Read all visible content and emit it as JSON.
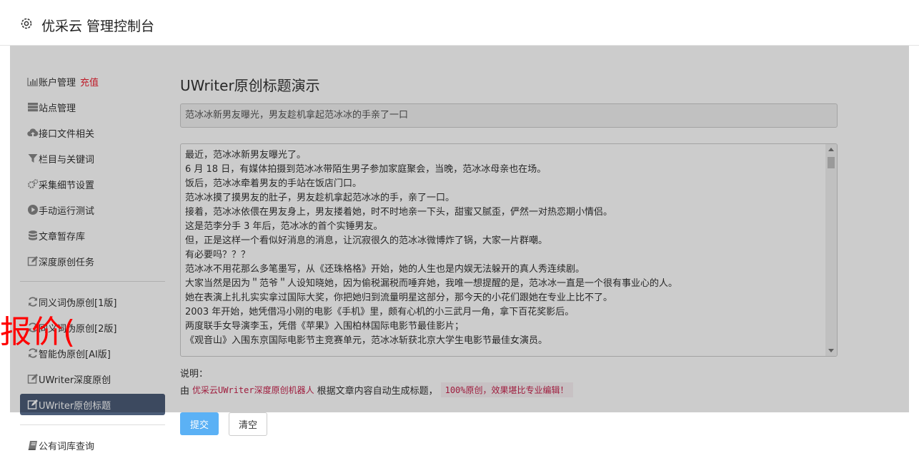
{
  "header": {
    "title": "优采云 管理控制台"
  },
  "sidebar": {
    "items": [
      {
        "label": "账户管理",
        "badge": "充值"
      },
      {
        "label": "站点管理"
      },
      {
        "label": "接口文件相关"
      },
      {
        "label": "栏目与关键词"
      },
      {
        "label": "采集细节设置"
      },
      {
        "label": "手动运行测试"
      },
      {
        "label": "文章暂存库"
      },
      {
        "label": "深度原创任务"
      },
      {
        "label": "同义词伪原创[1版]"
      },
      {
        "label": "同义词伪原创[2版]"
      },
      {
        "label": "智能伪原创[AI版]"
      },
      {
        "label": "UWriter深度原创"
      },
      {
        "label": "UWriter原创标题"
      },
      {
        "label": "公有词库查询"
      }
    ]
  },
  "main": {
    "title": "UWriter原创标题演示",
    "generated_title": "范冰冰新男友曝光，男友趁机拿起范冰冰的手亲了一口",
    "article_lines": [
      "最近，范冰冰新男友曝光了。",
      "6 月 18 日，有媒体拍摄到范冰冰带陌生男子参加家庭聚会，当晚，范冰冰母亲也在场。",
      "饭后，范冰冰牵着男友的手站在饭店门口。",
      "范冰冰摸了摸男友的肚子，男友趁机拿起范冰冰的手，亲了一口。",
      "接着，范冰冰依偎在男友身上，男友搂着她，时不时地亲一下头，甜蜜又腻歪，俨然一对热恋期小情侣。",
      "这是范李分手 3 年后，范冰冰的首个实锤男友。",
      "但，正是这样一个看似好消息的消息，让沉寂很久的范冰冰微博炸了锅，大家一片群嘲。",
      "有必要吗？？？",
      "范冰冰不用花那么多笔墨写，从《还珠格格》开始，她的人生也是内娱无法躲开的真人秀连续剧。",
      "大家当然是因为＂范爷＂人设知晓她，因为偷税漏税而唾弃她，我唯一想提醒的是，范冰冰一直是一个很有事业心的人。",
      "她在表演上扎扎实实拿过国际大奖，你把她归到流量明星这部分，那今天的小花们跟她在专业上比不了。",
      "2003 年开始，她凭借冯小刚的电影《手机》里，颇有心机的小三武月一角，拿下百花奖影后。",
      "两度联手女导演李玉，凭借《苹果》入围柏林国际电影节最佳影片；",
      "《观音山》入围东京国际电影节主竞赛单元，范冰冰斩获北京大学生电影节最佳女演员。"
    ],
    "note_label": "说明：",
    "note_prefix": "由",
    "note_code": "优采云UWriter深度原创机器人",
    "note_middle": "根据文章内容自动生成标题，",
    "note_highlight": "100%原创，效果堪比专业编辑！",
    "submit_label": "提交",
    "clear_label": "清空"
  },
  "overlay_text": "报价(",
  "colors": {
    "active_bg": "#4b5c77",
    "accent": "#5bb1f5",
    "badge": "#e23333",
    "overlay_text": "#ff0000"
  }
}
